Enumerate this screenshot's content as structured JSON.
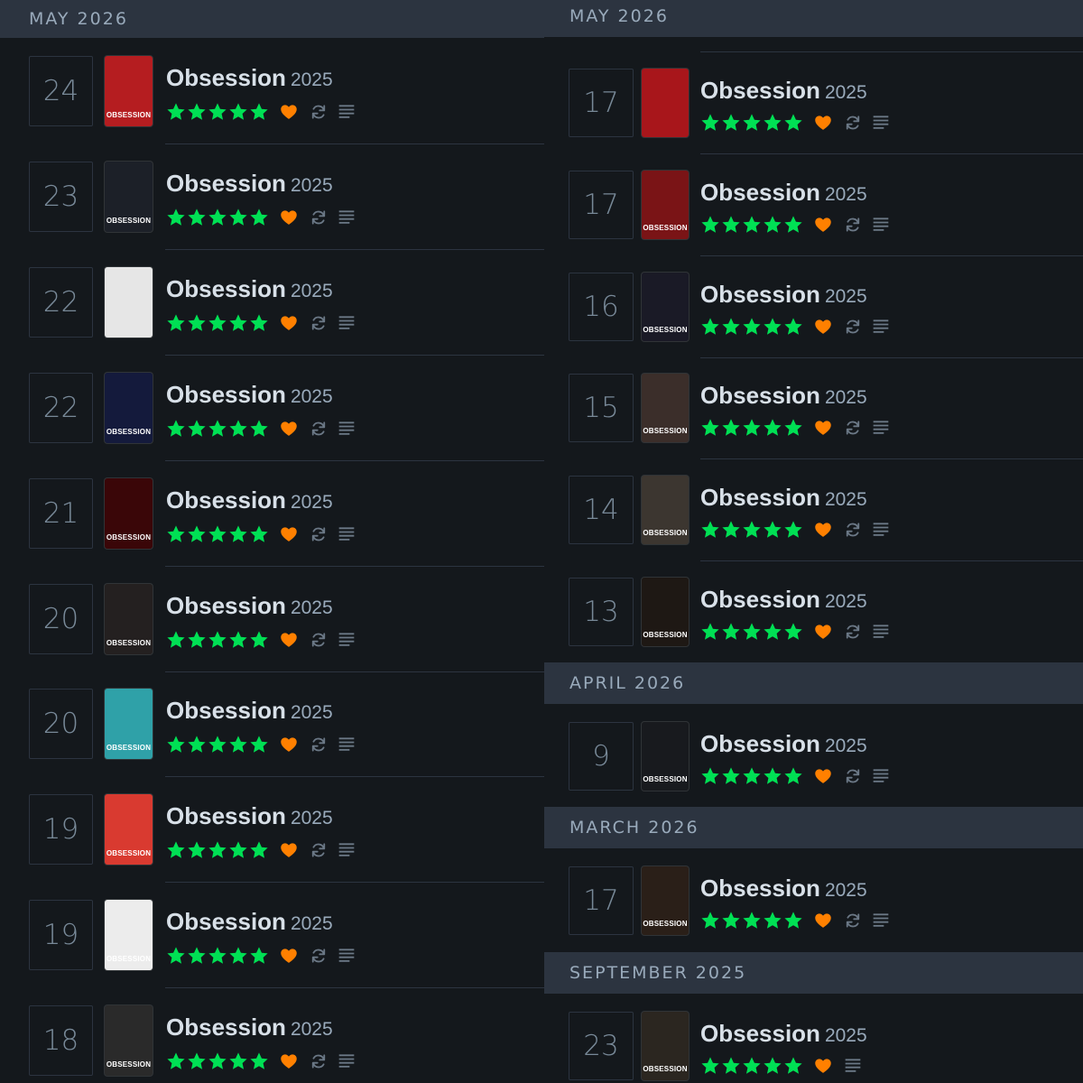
{
  "colors": {
    "background": "#14181c",
    "header_bg": "#2c3440",
    "header_text": "#99aabb",
    "title_text": "#d8e0e8",
    "star": "#00e054",
    "heart": "#ff8000",
    "muted_icon": "#6b7886"
  },
  "icons": {
    "star": "star-icon",
    "liked": "heart-icon",
    "rewatch": "rewatch-icon",
    "review": "review-lines-icon"
  },
  "left_column": {
    "header": "MAY 2026",
    "entries": [
      {
        "day": "24",
        "title": "Obsession",
        "year": "2025",
        "rating": 5,
        "liked": true,
        "rewatch": true,
        "review": true,
        "poster": {
          "bg": "#b51d20",
          "label": "OBSESSION"
        }
      },
      {
        "day": "23",
        "title": "Obsession",
        "year": "2025",
        "rating": 5,
        "liked": true,
        "rewatch": true,
        "review": true,
        "poster": {
          "bg": "#1c2028",
          "label": "OBSESSION"
        }
      },
      {
        "day": "22",
        "title": "Obsession",
        "year": "2025",
        "rating": 5,
        "liked": true,
        "rewatch": true,
        "review": true,
        "poster": {
          "bg": "#e6e6e6",
          "label": ""
        }
      },
      {
        "day": "22",
        "title": "Obsession",
        "year": "2025",
        "rating": 5,
        "liked": true,
        "rewatch": true,
        "review": true,
        "poster": {
          "bg": "#141a3c",
          "label": "OBSESSION"
        }
      },
      {
        "day": "21",
        "title": "Obsession",
        "year": "2025",
        "rating": 5,
        "liked": true,
        "rewatch": true,
        "review": true,
        "poster": {
          "bg": "#3a0608",
          "label": "OBSESSION"
        }
      },
      {
        "day": "20",
        "title": "Obsession",
        "year": "2025",
        "rating": 5,
        "liked": true,
        "rewatch": true,
        "review": true,
        "poster": {
          "bg": "#242020",
          "label": "OBSESSION"
        }
      },
      {
        "day": "20",
        "title": "Obsession",
        "year": "2025",
        "rating": 5,
        "liked": true,
        "rewatch": true,
        "review": true,
        "poster": {
          "bg": "#2fa1a8",
          "label": "OBSESSION"
        }
      },
      {
        "day": "19",
        "title": "Obsession",
        "year": "2025",
        "rating": 5,
        "liked": true,
        "rewatch": true,
        "review": true,
        "poster": {
          "bg": "#d93a30",
          "label": "OBSESSION"
        }
      },
      {
        "day": "19",
        "title": "Obsession",
        "year": "2025",
        "rating": 5,
        "liked": true,
        "rewatch": true,
        "review": true,
        "poster": {
          "bg": "#ececec",
          "label": "OBSESSION"
        }
      },
      {
        "day": "18",
        "title": "Obsession",
        "year": "2025",
        "rating": 5,
        "liked": true,
        "rewatch": true,
        "review": true,
        "poster": {
          "bg": "#2a2a2a",
          "label": "OBSESSION"
        }
      }
    ]
  },
  "right_column": {
    "sections": [
      {
        "header": "MAY 2026",
        "entries": [
          {
            "day": "17",
            "title": "Obsession",
            "year": "2025",
            "rating": 5,
            "liked": true,
            "rewatch": true,
            "review": true,
            "poster": {
              "bg": "#a8161b",
              "label": ""
            }
          },
          {
            "day": "17",
            "title": "Obsession",
            "year": "2025",
            "rating": 5,
            "liked": true,
            "rewatch": true,
            "review": true,
            "poster": {
              "bg": "#7a1416",
              "label": "OBSESSION"
            }
          },
          {
            "day": "16",
            "title": "Obsession",
            "year": "2025",
            "rating": 5,
            "liked": true,
            "rewatch": true,
            "review": true,
            "poster": {
              "bg": "#1a1a26",
              "label": "OBSESSION"
            }
          },
          {
            "day": "15",
            "title": "Obsession",
            "year": "2025",
            "rating": 5,
            "liked": true,
            "rewatch": true,
            "review": true,
            "poster": {
              "bg": "#3b2e2a",
              "label": "OBSESSION"
            }
          },
          {
            "day": "14",
            "title": "Obsession",
            "year": "2025",
            "rating": 5,
            "liked": true,
            "rewatch": true,
            "review": true,
            "poster": {
              "bg": "#3c3630",
              "label": "OBSESSION"
            }
          },
          {
            "day": "13",
            "title": "Obsession",
            "year": "2025",
            "rating": 5,
            "liked": true,
            "rewatch": true,
            "review": true,
            "poster": {
              "bg": "#1e1814",
              "label": "OBSESSION"
            }
          }
        ]
      },
      {
        "header": "APRIL 2026",
        "entries": [
          {
            "day": "9",
            "title": "Obsession",
            "year": "2025",
            "rating": 5,
            "liked": true,
            "rewatch": true,
            "review": true,
            "poster": {
              "bg": "#181a1e",
              "label": "OBSESSION"
            }
          }
        ]
      },
      {
        "header": "MARCH 2026",
        "entries": [
          {
            "day": "17",
            "title": "Obsession",
            "year": "2025",
            "rating": 5,
            "liked": true,
            "rewatch": true,
            "review": true,
            "poster": {
              "bg": "#2a1f18",
              "label": "OBSESSION"
            }
          }
        ]
      },
      {
        "header": "SEPTEMBER 2025",
        "entries": [
          {
            "day": "23",
            "title": "Obsession",
            "year": "2025",
            "rating": 5,
            "liked": true,
            "rewatch": false,
            "review": true,
            "poster": {
              "bg": "#2b2620",
              "label": "OBSESSION"
            }
          }
        ]
      }
    ]
  }
}
